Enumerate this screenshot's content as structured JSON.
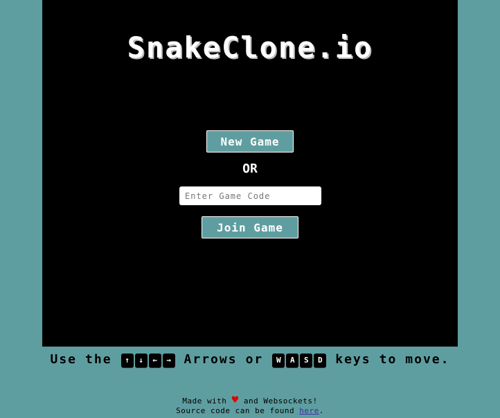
{
  "title": "SnakeClone.io",
  "menu": {
    "new_game_label": "New Game",
    "or_text": "OR",
    "code_placeholder": "Enter Game Code",
    "code_value": "",
    "join_game_label": "Join Game"
  },
  "instructions": {
    "use": "Use",
    "the": "the",
    "arrow_keys": [
      "↑",
      "↓",
      "←",
      "→"
    ],
    "arrows": "Arrows",
    "or": "or",
    "wasd_keys": [
      "W",
      "A",
      "S",
      "D"
    ],
    "keys": "keys",
    "to": "to",
    "move": "move."
  },
  "footer": {
    "made_with": "Made with",
    "heart": "♥",
    "and_websockets": "and Websockets!",
    "source_text": "Source code can be found",
    "link_label": "here",
    "period": "."
  },
  "colors": {
    "background": "#5f9ea0",
    "game_area": "#000000",
    "button": "#5f9ea0",
    "heart": "#e00000",
    "link": "#3a2fa3"
  },
  "icons": {
    "heart": "heart-icon",
    "arrow_up": "arrow-up-key",
    "arrow_down": "arrow-down-key",
    "arrow_left": "arrow-left-key",
    "arrow_right": "arrow-right-key"
  }
}
